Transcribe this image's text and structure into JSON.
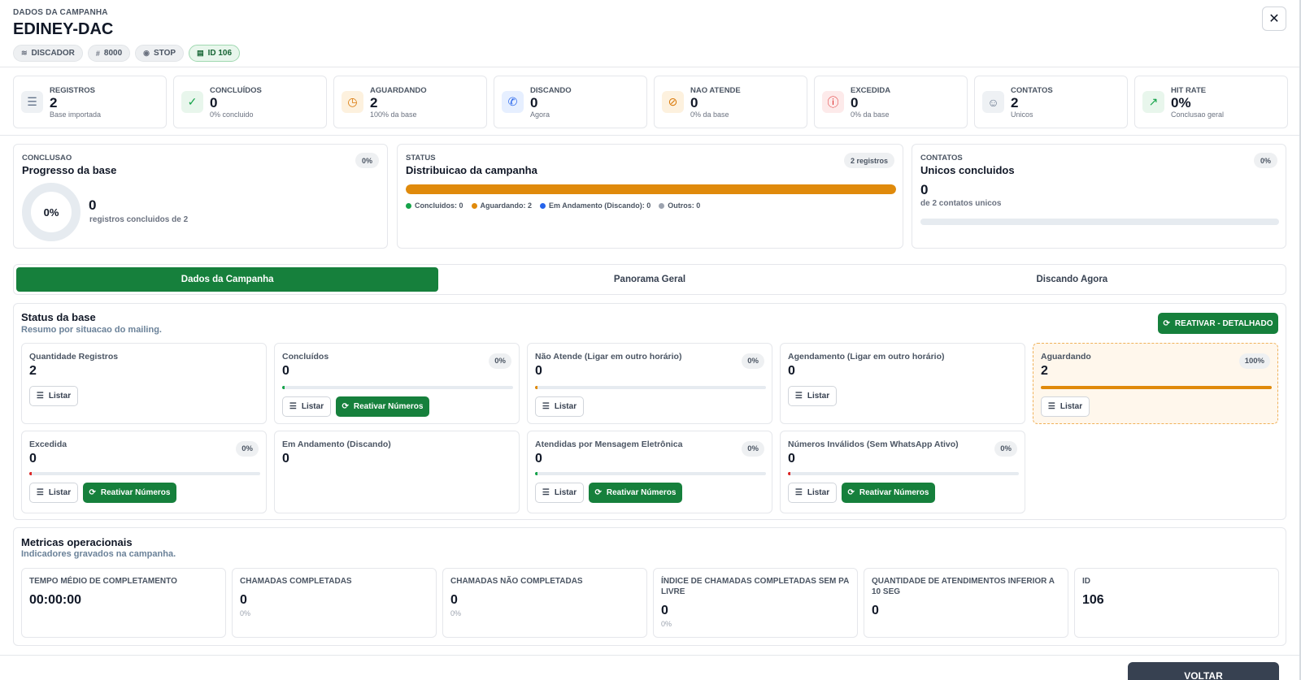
{
  "header": {
    "eyebrow": "DADOS DA CAMPANHA",
    "title": "EDINEY-DAC",
    "chips": [
      {
        "icon": "stack-icon",
        "label": "DISCADOR"
      },
      {
        "icon": "hash-icon",
        "label": "8000"
      },
      {
        "icon": "dot-icon",
        "label": "STOP"
      },
      {
        "icon": "id-card-icon",
        "label": "ID 106"
      }
    ],
    "close_icon": "close-icon"
  },
  "kpis": [
    {
      "label": "REGISTROS",
      "value": "2",
      "sub": "Base importada",
      "icon": "database-icon",
      "color": "#64748b",
      "bg": "#eef1f4"
    },
    {
      "label": "CONCLUÍDOS",
      "value": "0",
      "sub": "0% concluido",
      "icon": "check-circle-icon",
      "color": "#16a34a",
      "bg": "#e8f6ec"
    },
    {
      "label": "AGUARDANDO",
      "value": "2",
      "sub": "100% da base",
      "icon": "clock-icon",
      "color": "#d97706",
      "bg": "#fdf1de"
    },
    {
      "label": "DISCANDO",
      "value": "0",
      "sub": "Agora",
      "icon": "phone-icon",
      "color": "#2563eb",
      "bg": "#e6efff"
    },
    {
      "label": "NAO ATENDE",
      "value": "0",
      "sub": "0% da base",
      "icon": "phone-missed-icon",
      "color": "#d97706",
      "bg": "#fdf1de"
    },
    {
      "label": "EXCEDIDA",
      "value": "0",
      "sub": "0% da base",
      "icon": "alert-circle-icon",
      "color": "#dc2626",
      "bg": "#fdeaea"
    },
    {
      "label": "CONTATOS",
      "value": "2",
      "sub": "Unicos",
      "icon": "user-icon",
      "color": "#64748b",
      "bg": "#eef1f4"
    },
    {
      "label": "HIT RATE",
      "value": "0%",
      "sub": "Conclusao geral",
      "icon": "trend-icon",
      "color": "#16a34a",
      "bg": "#e8f6ec"
    }
  ],
  "progress": {
    "eyebrow": "CONCLUSAO",
    "title": "Progresso da base",
    "pill": "0%",
    "donut_label": "0%",
    "value": "0",
    "caption": "registros concluidos de 2"
  },
  "distribution": {
    "eyebrow": "STATUS",
    "title": "Distribuicao da campanha",
    "pill": "2 registros",
    "aguardando_fraction": 1.0,
    "legend": [
      {
        "label": "Concluidos: 0",
        "color": "#16a34a"
      },
      {
        "label": "Aguardando: 2",
        "color": "#e08a0b"
      },
      {
        "label": "Em Andamento (Discando): 0",
        "color": "#2563eb"
      },
      {
        "label": "Outros: 0",
        "color": "#9ca3af"
      }
    ]
  },
  "unique_contacts": {
    "eyebrow": "CONTATOS",
    "title": "Unicos concluidos",
    "pill": "0%",
    "value": "0",
    "caption": "de 2 contatos unicos",
    "fraction": 0
  },
  "tabs": [
    {
      "label": "Dados da Campanha",
      "active": true
    },
    {
      "label": "Panorama Geral",
      "active": false
    },
    {
      "label": "Discando Agora",
      "active": false
    }
  ],
  "status_base": {
    "title": "Status da base",
    "subtitle": "Resumo por situacao do mailing.",
    "reactivate_detailed": "REATIVAR - DETALHADO",
    "list_label": "Listar",
    "reactivate_label": "Reativar Números",
    "cards": [
      {
        "label": "Quantidade Registros",
        "value": "2"
      },
      {
        "label": "Concluídos",
        "value": "0",
        "pill": "0%",
        "fraction": 0,
        "bar_color": "#16a34a"
      },
      {
        "label": "Não Atende (Ligar em outro horário)",
        "value": "0",
        "pill": "0%",
        "fraction": 0,
        "bar_color": "#e08a0b"
      },
      {
        "label": "Agendamento (Ligar em outro horário)",
        "value": "0"
      },
      {
        "label": "Aguardando",
        "value": "2",
        "pill": "100%",
        "fraction": 1.0,
        "bar_color": "#e08a0b"
      },
      {
        "label": "Excedida",
        "value": "0",
        "pill": "0%",
        "fraction": 0,
        "bar_color": "#dc2626"
      },
      {
        "label": "Em Andamento (Discando)",
        "value": "0"
      },
      {
        "label": "Atendidas por Mensagem Eletrônica",
        "value": "0",
        "pill": "0%",
        "fraction": 0,
        "bar_color": "#16a34a"
      },
      {
        "label": "Números Inválidos (Sem WhatsApp Ativo)",
        "value": "0",
        "pill": "0%",
        "fraction": 0,
        "bar_color": "#dc2626"
      }
    ]
  },
  "metrics": {
    "title": "Metricas operacionais",
    "subtitle": "Indicadores gravados na campanha.",
    "cards": [
      {
        "label": "TEMPO MÉDIO DE COMPLETAMENTO",
        "value": "00:00:00",
        "sub": ""
      },
      {
        "label": "CHAMADAS COMPLETADAS",
        "value": "0",
        "sub": "0%"
      },
      {
        "label": "CHAMADAS NÃO COMPLETADAS",
        "value": "0",
        "sub": "0%"
      },
      {
        "label": "ÍNDICE DE CHAMADAS COMPLETADAS SEM PA LIVRE",
        "value": "0",
        "sub": "0%"
      },
      {
        "label": "QUANTIDADE DE ATENDIMENTOS INFERIOR A 10 SEG",
        "value": "0",
        "sub": ""
      },
      {
        "label": "ID",
        "value": "106",
        "sub": ""
      }
    ]
  },
  "footer": {
    "back_label": "VOLTAR"
  }
}
